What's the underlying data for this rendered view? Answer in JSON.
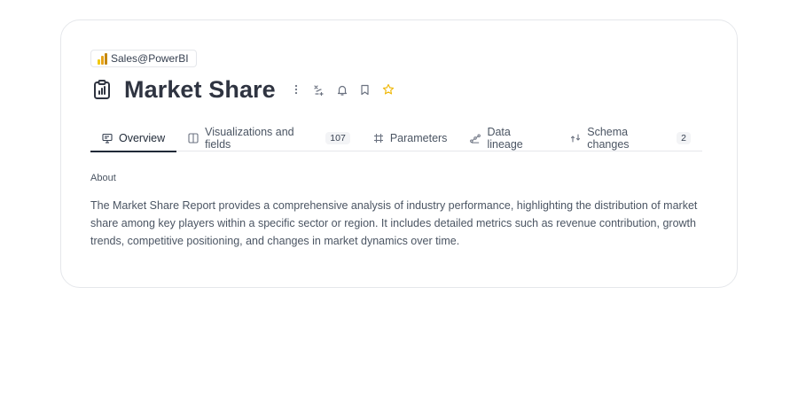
{
  "source": {
    "label": "Sales@PowerBI",
    "icon": "powerbi-icon",
    "brand_colors": [
      "#f2c811",
      "#e8a317",
      "#c4880c"
    ]
  },
  "header": {
    "title": "Market Share",
    "icon": "report-clipboard-icon",
    "actions": [
      "more-vertical-icon",
      "lineage-sparkle-icon",
      "bell-icon",
      "bookmark-icon",
      "star-icon"
    ],
    "star_color": "#f0b90b"
  },
  "tabs": [
    {
      "label": "Overview",
      "icon": "monitor-icon",
      "active": true
    },
    {
      "label": "Visualizations and fields",
      "icon": "columns-icon",
      "count": "107"
    },
    {
      "label": "Parameters",
      "icon": "hash-frame-icon"
    },
    {
      "label": "Data lineage",
      "icon": "lineage-icon"
    },
    {
      "label": "Schema changes",
      "icon": "arrows-icon",
      "count": "2"
    }
  ],
  "about": {
    "label": "About",
    "text": "The Market Share Report provides a comprehensive analysis of industry performance, highlighting the distribution of market share among key players within a specific sector or region. It includes detailed metrics such as revenue contribution, growth trends, competitive positioning, and changes in market dynamics over time."
  }
}
